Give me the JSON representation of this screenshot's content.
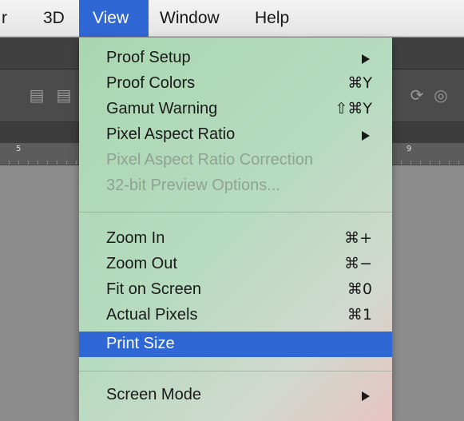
{
  "menubar": {
    "items": [
      {
        "label": "r"
      },
      {
        "label": "3D"
      },
      {
        "label": "View"
      },
      {
        "label": "Window"
      },
      {
        "label": "Help"
      }
    ]
  },
  "rulers": {
    "left_label": "5",
    "right_label": "9"
  },
  "view_menu": {
    "items": [
      {
        "label": "Proof Setup",
        "shortcut": "",
        "submenu": true
      },
      {
        "label": "Proof Colors",
        "shortcut": "⌘Y"
      },
      {
        "label": "Gamut Warning",
        "shortcut": "⇧⌘Y"
      },
      {
        "label": "Pixel Aspect Ratio",
        "shortcut": "",
        "submenu": true
      },
      {
        "label": "Pixel Aspect Ratio Correction",
        "disabled": true
      },
      {
        "label": "32-bit Preview Options...",
        "disabled": true
      },
      {
        "label": "Zoom In",
        "shortcut": "⌘+"
      },
      {
        "label": "Zoom Out",
        "shortcut": "⌘−"
      },
      {
        "label": "Fit on Screen",
        "shortcut": "⌘0"
      },
      {
        "label": "Actual Pixels",
        "shortcut": "⌘1"
      },
      {
        "label": "Print Size",
        "shortcut": "",
        "selected": true
      },
      {
        "label": "Screen Mode",
        "shortcut": "",
        "submenu": true
      }
    ]
  },
  "colors": {
    "selection": "#2f67d5",
    "menu_tint": "#b2d9b9",
    "menubar_bg": "#ececec"
  }
}
